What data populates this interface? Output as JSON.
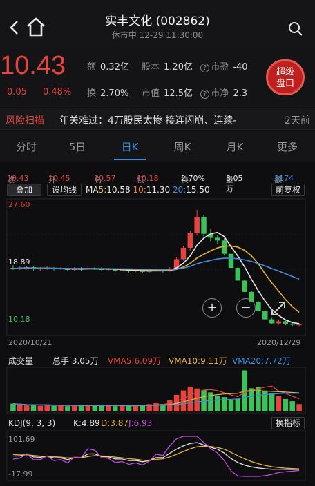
{
  "header": {
    "back_icon": "chevron-left-icon",
    "home_icon": "home-icon",
    "title": "实丰文化 (002862)",
    "subtitle": "休市中 12-29 11:30:00",
    "search_icon": "search-icon"
  },
  "quote": {
    "price": "10.43",
    "change": "0.05",
    "change_pct": "0.48%",
    "stats": [
      {
        "k": "额",
        "v": "0.32亿"
      },
      {
        "k": "股本",
        "v": "1.20亿"
      },
      {
        "k": "市盈",
        "v": "-40"
      },
      {
        "k": "换",
        "v": "2.70%"
      },
      {
        "k": "市值",
        "v": "12.5亿"
      },
      {
        "k": "市净",
        "v": "2.3"
      }
    ],
    "super_btn": "超级\n盘口"
  },
  "risk": {
    "label": "风险扫描",
    "text": "年关难过：4万股民太惨 接连闪崩、连续-",
    "date": "2天前"
  },
  "tabs": [
    "分时",
    "5日",
    "日K",
    "周K",
    "月K",
    "更多"
  ],
  "ohlc_bar": {
    "shou": "收:",
    "shou_v": "10.43",
    "kai": "开:",
    "kai_v": "10.45",
    "gao": "高:",
    "gao_v": "10.57",
    "di": "低:",
    "di_v": "10.18",
    "huan": "换:",
    "huan_v": "2.70%",
    "liang": "量:",
    "liang_v": "3.05万",
    "e": "额:",
    "e_v": "3174"
  },
  "ma_bar": {
    "overlay_btn": "叠加",
    "set_btn": "设均线",
    "ma": "MA",
    "ma5_label": "5:",
    "ma5": "10.58",
    "ma10_label": "10:",
    "ma10": "11.30",
    "ma20_label": "20:",
    "ma20": "15.50",
    "fuquan_btn": "前复权"
  },
  "price_axis": {
    "high": "27.60",
    "mid": "18.89",
    "low": "10.18"
  },
  "date_axis": {
    "start": "2020/10/21",
    "end": "2020/12/29"
  },
  "volume_bar": {
    "title": "成交量",
    "total_label": "总手",
    "total": "3.05万",
    "vma5": "VMA5:6.09万",
    "vma10": "VMA10:9.11万",
    "vma20": "VMA20:7.72万"
  },
  "kdj_bar": {
    "title": "KDJ(9, 3, 3)",
    "k": "K:4.89",
    "d": "D:3.87",
    "j": "J:6.93",
    "switch_btn": "换指标",
    "top": "101.69",
    "bottom": "-17.99"
  },
  "colors": {
    "up": "#e8433d",
    "down": "#3cc25a",
    "ma5": "#e6e6e6",
    "ma10": "#e5b53a",
    "ma20": "#3a8fe0"
  },
  "chart_data": {
    "type": "candlestick",
    "candles": [
      [
        18.9,
        18.8,
        19.3,
        18.6
      ],
      [
        18.8,
        18.9,
        19.2,
        18.6
      ],
      [
        18.9,
        19.0,
        19.2,
        18.7
      ],
      [
        19.0,
        18.7,
        19.1,
        18.5
      ],
      [
        18.7,
        18.8,
        19.0,
        18.5
      ],
      [
        18.8,
        18.9,
        19.1,
        18.6
      ],
      [
        18.9,
        18.7,
        19.0,
        18.5
      ],
      [
        18.7,
        18.8,
        19.0,
        18.6
      ],
      [
        18.8,
        18.6,
        18.9,
        18.4
      ],
      [
        18.6,
        18.8,
        19.0,
        18.5
      ],
      [
        18.8,
        18.7,
        19.0,
        18.5
      ],
      [
        18.7,
        18.9,
        19.1,
        18.6
      ],
      [
        18.9,
        18.8,
        19.2,
        18.6
      ],
      [
        18.8,
        18.6,
        19.0,
        18.4
      ],
      [
        18.6,
        18.7,
        18.9,
        18.5
      ],
      [
        18.7,
        18.5,
        18.8,
        18.3
      ],
      [
        18.5,
        18.6,
        18.8,
        18.4
      ],
      [
        18.6,
        18.4,
        18.7,
        18.2
      ],
      [
        18.4,
        18.5,
        18.7,
        18.3
      ],
      [
        18.5,
        18.3,
        18.6,
        18.1
      ],
      [
        18.3,
        18.5,
        18.7,
        18.2
      ],
      [
        18.5,
        18.6,
        18.8,
        18.4
      ],
      [
        18.6,
        18.4,
        18.7,
        18.2
      ],
      [
        18.4,
        18.8,
        19.0,
        18.3
      ],
      [
        18.8,
        20.2,
        20.5,
        18.7
      ],
      [
        20.2,
        21.9,
        22.2,
        20.0
      ],
      [
        21.9,
        24.1,
        24.4,
        21.5
      ],
      [
        24.1,
        26.5,
        27.6,
        23.8
      ],
      [
        26.5,
        24.0,
        26.8,
        23.5
      ],
      [
        24.0,
        23.4,
        24.8,
        22.9
      ],
      [
        23.4,
        23.0,
        23.8,
        22.4
      ],
      [
        23.0,
        21.0,
        23.4,
        20.8
      ],
      [
        21.0,
        18.9,
        21.2,
        18.9
      ],
      [
        18.9,
        17.0,
        19.1,
        17.0
      ],
      [
        17.0,
        15.3,
        17.2,
        15.3
      ],
      [
        15.3,
        13.8,
        15.5,
        13.8
      ],
      [
        13.8,
        12.4,
        14.0,
        12.4
      ],
      [
        12.4,
        11.2,
        12.6,
        11.2
      ],
      [
        11.2,
        10.6,
        11.5,
        10.5
      ],
      [
        10.6,
        10.9,
        11.2,
        10.4
      ],
      [
        10.9,
        10.5,
        11.0,
        10.3
      ],
      [
        10.5,
        10.4,
        10.7,
        10.2
      ],
      [
        10.4,
        10.43,
        10.57,
        10.18
      ]
    ],
    "price_range": [
      10.18,
      27.6
    ],
    "ma": {
      "MA5": "10.58",
      "MA10": "11.30",
      "MA20": "15.50"
    },
    "volume": [
      3.2,
      2.8,
      2.5,
      2.7,
      2.4,
      2.6,
      2.3,
      2.5,
      2.2,
      2.4,
      2.6,
      2.5,
      2.7,
      2.3,
      2.4,
      2.2,
      2.5,
      2.3,
      2.4,
      2.6,
      3.0,
      3.4,
      3.1,
      4.5,
      6.8,
      8.6,
      10.2,
      9.4,
      8.7,
      7.8,
      6.5,
      5.9,
      4.8,
      5.2,
      16.8,
      9.5,
      10.1,
      8.2,
      7.4,
      6.3,
      5.1,
      4.2,
      3.05
    ],
    "kdj_range": [
      -17.99,
      101.69
    ]
  }
}
